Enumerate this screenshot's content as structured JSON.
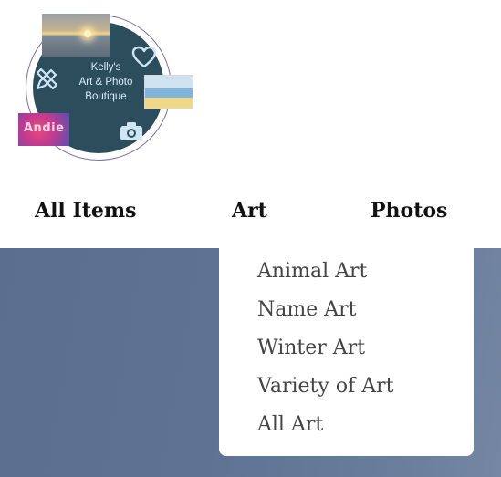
{
  "logo": {
    "line1": "Kelly's",
    "line2": "Art & Photo",
    "line3": "Boutique",
    "name_art_text": "Andie",
    "disc_color": "#2c4e5c",
    "ring_color": "#7b6fa8",
    "icons": [
      "heart-icon",
      "pencil-ruler-icon",
      "camera-icon"
    ]
  },
  "nav": {
    "items": [
      {
        "label": "All Items"
      },
      {
        "label": "Art"
      },
      {
        "label": "Photos"
      }
    ]
  },
  "dropdown": {
    "parent": "Art",
    "items": [
      {
        "label": "Animal Art"
      },
      {
        "label": "Name Art"
      },
      {
        "label": "Winter Art"
      },
      {
        "label": "Variety of Art"
      },
      {
        "label": "All Art"
      }
    ]
  },
  "colors": {
    "hero_background": "#5e7393",
    "text": "#111111",
    "dropdown_text": "#444444"
  }
}
